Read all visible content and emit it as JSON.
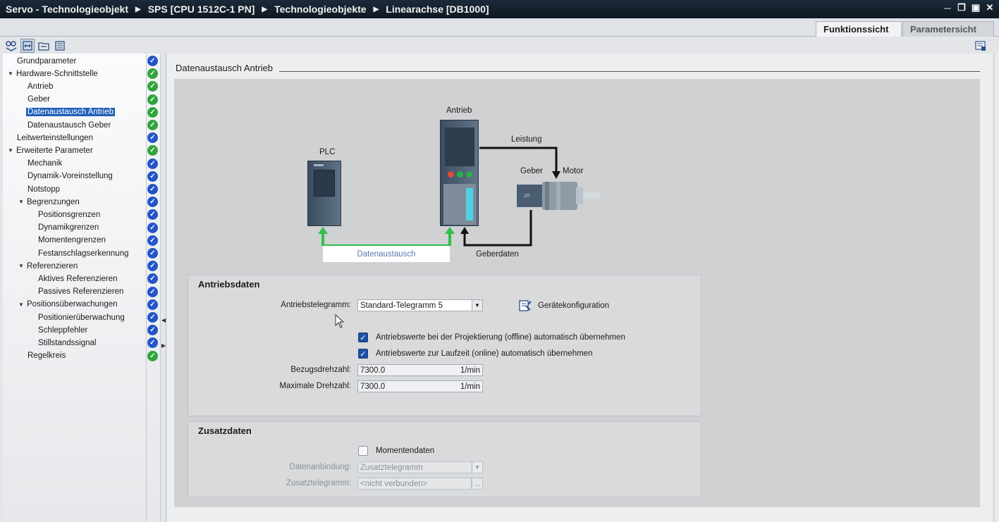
{
  "window": {
    "breadcrumb": [
      "Servo - Technologieobjekt",
      "SPS [CPU 1512C-1 PN]",
      "Technologieobjekte",
      "Linearachse [DB1000]"
    ],
    "controls": [
      "minimize-icon",
      "restore-icon",
      "float-icon",
      "close-icon"
    ]
  },
  "view_tabs": [
    {
      "label": "Funktionssicht",
      "active": true
    },
    {
      "label": "Parametersicht",
      "active": false
    }
  ],
  "nav": {
    "items": [
      {
        "label": "Grundparameter",
        "level": 0,
        "expandable": false,
        "status": "blue"
      },
      {
        "label": "Hardware-Schnittstelle",
        "level": 0,
        "expandable": true,
        "status": "green"
      },
      {
        "label": "Antrieb",
        "level": 1,
        "expandable": false,
        "status": "green"
      },
      {
        "label": "Geber",
        "level": 1,
        "expandable": false,
        "status": "green"
      },
      {
        "label": "Datenaustausch Antrieb",
        "level": 1,
        "expandable": false,
        "status": "green",
        "selected": true
      },
      {
        "label": "Datenaustausch Geber",
        "level": 1,
        "expandable": false,
        "status": "green"
      },
      {
        "label": "Leitwerteinstellungen",
        "level": 0,
        "expandable": false,
        "status": "blue"
      },
      {
        "label": "Erweiterte Parameter",
        "level": 0,
        "expandable": true,
        "status": "green"
      },
      {
        "label": "Mechanik",
        "level": 1,
        "expandable": false,
        "status": "blue"
      },
      {
        "label": "Dynamik-Voreinstellung",
        "level": 1,
        "expandable": false,
        "status": "blue"
      },
      {
        "label": "Notstopp",
        "level": 1,
        "expandable": false,
        "status": "blue"
      },
      {
        "label": "Begrenzungen",
        "level": 1,
        "expandable": true,
        "status": "blue"
      },
      {
        "label": "Positionsgrenzen",
        "level": 2,
        "expandable": false,
        "status": "blue"
      },
      {
        "label": "Dynamikgrenzen",
        "level": 2,
        "expandable": false,
        "status": "blue"
      },
      {
        "label": "Momentengrenzen",
        "level": 2,
        "expandable": false,
        "status": "blue"
      },
      {
        "label": "Festanschlagserkennung",
        "level": 2,
        "expandable": false,
        "status": "blue"
      },
      {
        "label": "Referenzieren",
        "level": 1,
        "expandable": true,
        "status": "blue"
      },
      {
        "label": "Aktives Referenzieren",
        "level": 2,
        "expandable": false,
        "status": "blue"
      },
      {
        "label": "Passives Referenzieren",
        "level": 2,
        "expandable": false,
        "status": "blue"
      },
      {
        "label": "Positionsüberwachungen",
        "level": 1,
        "expandable": true,
        "status": "blue"
      },
      {
        "label": "Positionierüberwachung",
        "level": 2,
        "expandable": false,
        "status": "blue"
      },
      {
        "label": "Schleppfehler",
        "level": 2,
        "expandable": false,
        "status": "blue"
      },
      {
        "label": "Stillstandssignal",
        "level": 2,
        "expandable": false,
        "status": "blue"
      },
      {
        "label": "Regelkreis",
        "level": 1,
        "expandable": false,
        "status": "green"
      }
    ]
  },
  "section": {
    "title": "Datenaustausch Antrieb"
  },
  "diagram": {
    "plc_label": "PLC",
    "drive_label": "Antrieb",
    "power_label": "Leistung",
    "encoder_label": "Geber",
    "motor_label": "Motor",
    "exchange_label": "Datenaustausch",
    "encoder_data_label": "Geberdaten",
    "colors": {
      "exchange": "#2fbf4a",
      "power": "#111111"
    }
  },
  "antriebsdaten": {
    "title": "Antriebsdaten",
    "telegram_label": "Antriebstelegramm:",
    "telegram_value": "Standard-Telegramm 5",
    "device_config_label": "Gerätekonfiguration",
    "offline_label": "Antriebswerte bei der Projektierung (offline) automatisch übernehmen",
    "online_label": "Antriebswerte zur Laufzeit (online) automatisch übernehmen",
    "ref_speed_label": "Bezugsdrehzahl:",
    "ref_speed_value": "7300.0",
    "ref_speed_unit": "1/min",
    "max_speed_label": "Maximale Drehzahl:",
    "max_speed_value": "7300.0",
    "max_speed_unit": "1/min"
  },
  "zusatzdaten": {
    "title": "Zusatzdaten",
    "torque_label": "Momentendaten",
    "connection_label": "Datenanbindung:",
    "connection_value": "Zusatztelegramm",
    "extra_telegram_label": "Zusatztelegramm:",
    "extra_telegram_value": "<nicht verbunden>",
    "browse_label": "..."
  }
}
